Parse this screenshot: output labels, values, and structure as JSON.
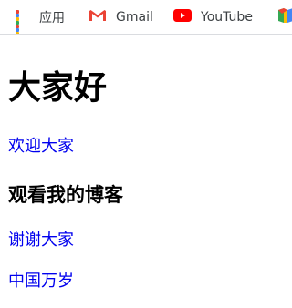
{
  "bookmarks": {
    "apps_label": "应用",
    "gmail_label": "Gmail",
    "youtube_label": "YouTube",
    "icons": {
      "apps": "apps-grid-icon",
      "gmail": "gmail-icon",
      "youtube": "youtube-icon",
      "maps": "maps-icon"
    },
    "colors": {
      "apps_grid": [
        "#ea4335",
        "#4285f4",
        "#fbbc05",
        "#34a853",
        "#ea4335",
        "#4285f4",
        "#fbbc05",
        "#34a853",
        "#ea4335"
      ],
      "youtube_red": "#ff0000",
      "gmail_red": "#ea4335"
    }
  },
  "page": {
    "heading": "大家好",
    "link1": "欢迎大家",
    "subheading": "观看我的博客",
    "link2": "谢谢大家",
    "link3": "中国万岁"
  },
  "colors": {
    "link": "#0000ee",
    "text": "#000000"
  }
}
